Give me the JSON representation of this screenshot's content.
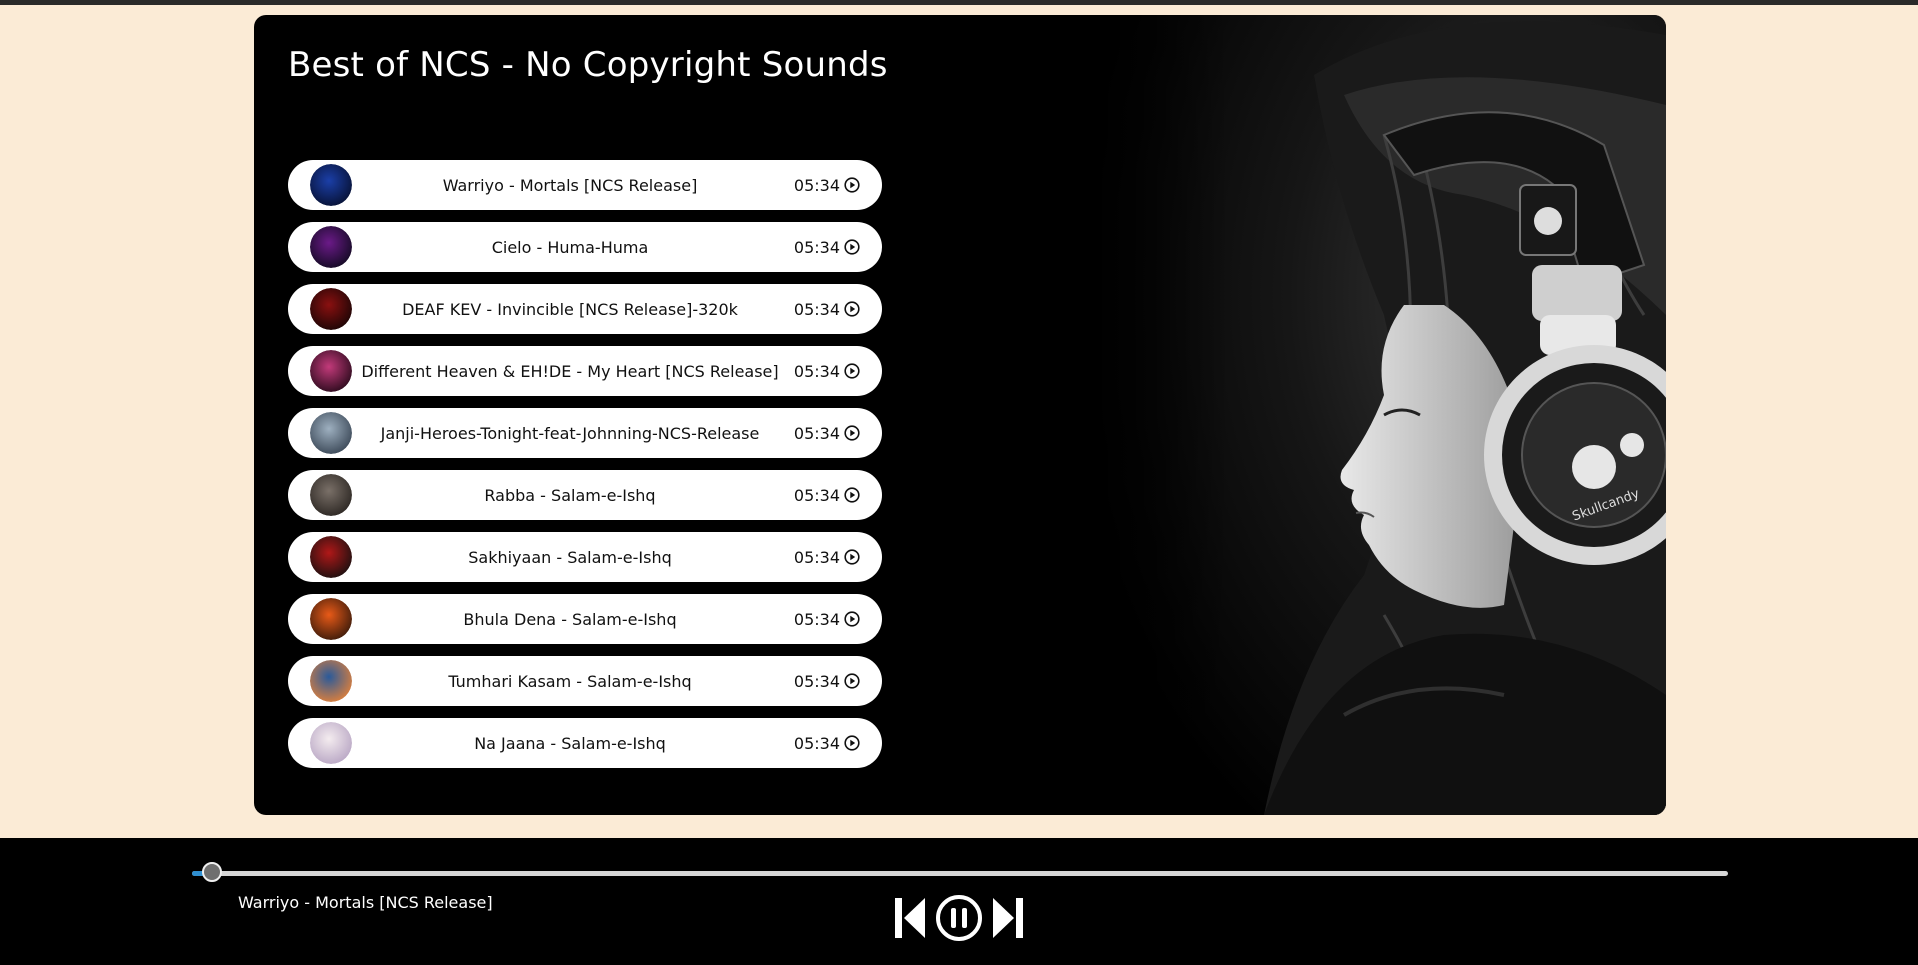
{
  "page": {
    "title": "Best of NCS - No Copyright Sounds",
    "background": "#fbebd6"
  },
  "songs": [
    {
      "name": "Warriyo - Mortals [NCS Release]",
      "duration": "05:34",
      "cover_colors": [
        "#1b3fa8",
        "#071133"
      ]
    },
    {
      "name": "Cielo - Huma-Huma",
      "duration": "05:34",
      "cover_colors": [
        "#6b1a88",
        "#120a22"
      ]
    },
    {
      "name": "DEAF KEV - Invincible [NCS Release]-320k",
      "duration": "05:34",
      "cover_colors": [
        "#8a1010",
        "#1a0505"
      ]
    },
    {
      "name": "Different Heaven & EH!DE - My Heart [NCS Release]",
      "duration": "05:34",
      "cover_colors": [
        "#c23a7a",
        "#2a0a1c"
      ]
    },
    {
      "name": "Janji-Heroes-Tonight-feat-Johnning-NCS-Release",
      "duration": "05:34",
      "cover_colors": [
        "#9eb0c0",
        "#3a4756"
      ]
    },
    {
      "name": "Rabba - Salam-e-Ishq",
      "duration": "05:34",
      "cover_colors": [
        "#7a7068",
        "#2b2622"
      ]
    },
    {
      "name": "Sakhiyaan - Salam-e-Ishq",
      "duration": "05:34",
      "cover_colors": [
        "#b01818",
        "#1a1010"
      ]
    },
    {
      "name": "Bhula Dena - Salam-e-Ishq",
      "duration": "05:34",
      "cover_colors": [
        "#e85a18",
        "#3a1a0a"
      ]
    },
    {
      "name": "Tumhari Kasam - Salam-e-Ishq",
      "duration": "05:34",
      "cover_colors": [
        "#2a5a9a",
        "#e0803a"
      ]
    },
    {
      "name": "Na Jaana - Salam-e-Ishq",
      "duration": "05:34",
      "cover_colors": [
        "#f4ecef",
        "#b8a6c4"
      ]
    }
  ],
  "player": {
    "now_playing": "Warriyo - Mortals [NCS Release]",
    "progress_percent": 1.3,
    "accent_color": "#2f8fd0",
    "controls": [
      "previous-icon",
      "pause-icon",
      "next-icon"
    ]
  },
  "hero_image": {
    "description_icon": "headphones-woman-photo"
  }
}
